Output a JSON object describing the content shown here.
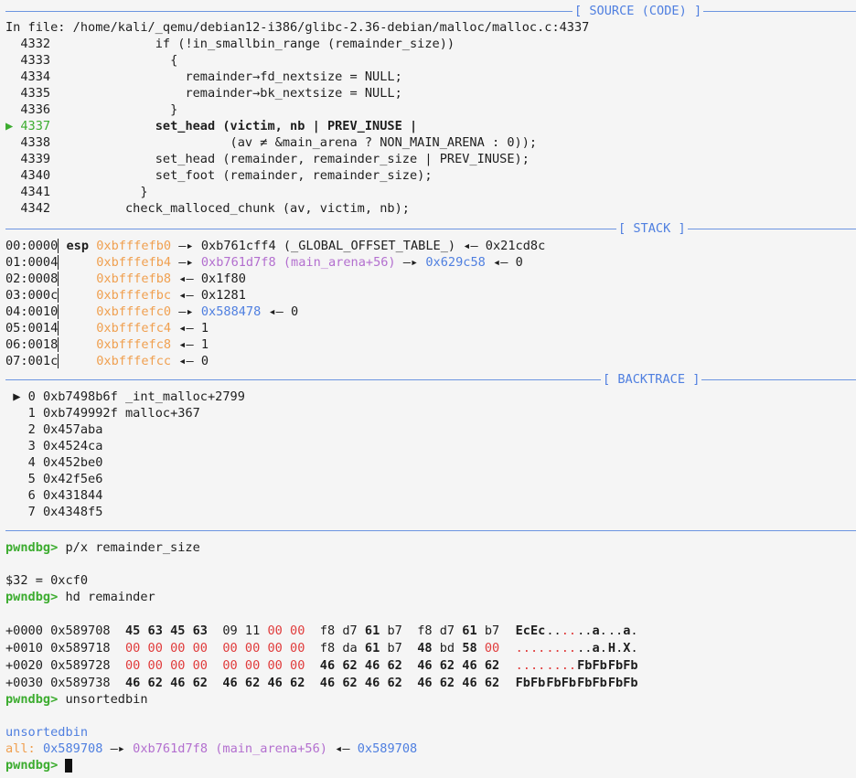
{
  "source": {
    "header": "[ SOURCE (CODE) ]",
    "file_line": "In file: /home/kali/_qemu/debian12-i386/glibc-2.36-debian/malloc/malloc.c:4337",
    "current_marker": "▶",
    "lines": [
      {
        "num": "4332",
        "code": "              if (!in_smallbin_range (remainder_size))"
      },
      {
        "num": "4333",
        "code": "                {"
      },
      {
        "num": "4334",
        "code": "                  remainder→fd_nextsize = NULL;"
      },
      {
        "num": "4335",
        "code": "                  remainder→bk_nextsize = NULL;"
      },
      {
        "num": "4336",
        "code": "                }"
      },
      {
        "num": "4337",
        "code": "              set_head (victim, nb | PREV_INUSE |"
      },
      {
        "num": "4338",
        "code": "                        (av ≠ &main_arena ? NON_MAIN_ARENA : 0));"
      },
      {
        "num": "4339",
        "code": "              set_head (remainder, remainder_size | PREV_INUSE);"
      },
      {
        "num": "4340",
        "code": "              set_foot (remainder, remainder_size);"
      },
      {
        "num": "4341",
        "code": "            }"
      },
      {
        "num": "4342",
        "code": "          check_malloced_chunk (av, victim, nb);"
      }
    ]
  },
  "stack": {
    "header": "[ STACK ]",
    "rows": [
      {
        "off": "00:0000",
        "reg": "esp",
        "addr": "0xbfffefb0",
        "rest1": " —▸ 0xb761cff4 (_GLOBAL_OFFSET_TABLE_) ◂— 0x21cd8c"
      },
      {
        "off": "01:0004",
        "reg": "",
        "addr": "0xbfffefb4",
        "rest1": " —▸ ",
        "sym": "0xb761d7f8 (main_arena+56)",
        "rest2": " —▸ ",
        "ptr": "0x629c58",
        "rest3": " ◂— 0"
      },
      {
        "off": "02:0008",
        "reg": "",
        "addr": "0xbfffefb8",
        "rest1": " ◂— 0x1f80"
      },
      {
        "off": "03:000c",
        "reg": "",
        "addr": "0xbfffefbc",
        "rest1": " ◂— 0x1281"
      },
      {
        "off": "04:0010",
        "reg": "",
        "addr": "0xbfffefc0",
        "rest1": " —▸ ",
        "ptr": "0x588478",
        "rest3": " ◂— 0"
      },
      {
        "off": "05:0014",
        "reg": "",
        "addr": "0xbfffefc4",
        "rest1": " ◂— 1"
      },
      {
        "off": "06:0018",
        "reg": "",
        "addr": "0xbfffefc8",
        "rest1": " ◂— 1"
      },
      {
        "off": "07:001c",
        "reg": "",
        "addr": "0xbfffefcc",
        "rest1": " ◂— 0"
      }
    ]
  },
  "backtrace": {
    "header": "[ BACKTRACE ]",
    "marker": "▶",
    "frames": [
      {
        "idx": "0",
        "addr": "0xb7498b6f",
        "sym": "_int_malloc+2799"
      },
      {
        "idx": "1",
        "addr": "0xb749992f",
        "sym": "malloc+367"
      },
      {
        "idx": "2",
        "addr": "0x457aba",
        "sym": ""
      },
      {
        "idx": "3",
        "addr": "0x4524ca",
        "sym": ""
      },
      {
        "idx": "4",
        "addr": "0x452be0",
        "sym": ""
      },
      {
        "idx": "5",
        "addr": "0x42f5e6",
        "sym": ""
      },
      {
        "idx": "6",
        "addr": "0x431844",
        "sym": ""
      },
      {
        "idx": "7",
        "addr": "0x4348f5",
        "sym": ""
      }
    ]
  },
  "session": {
    "prompt": "pwndbg>",
    "cmd1": " p/x remainder_size",
    "result1": "$32 = 0xcf0",
    "cmd2": " hd remainder",
    "hexdump": [
      {
        "off": "+0000",
        "addr": "0x589708"
      },
      {
        "off": "+0010",
        "addr": "0x589718"
      },
      {
        "off": "+0020",
        "addr": "0x589728"
      },
      {
        "off": "+0030",
        "addr": "0x589738"
      }
    ],
    "cmd3": " unsortedbin",
    "bin_title": "unsortedbin",
    "bin_label": "all:",
    "bin_head": "0x589708",
    "bin_arrow": " —▸ ",
    "bin_sym": "0xb761d7f8 (main_arena+56)",
    "bin_back": " ◂— ",
    "bin_tail": "0x589708"
  },
  "colors": {
    "separator": "#6c95e0",
    "prompt": "#3cac2f",
    "address": "#f0a050",
    "symbol": "#b36fcf",
    "pointer": "#4f7fe0",
    "null_byte": "#e03c3c"
  }
}
